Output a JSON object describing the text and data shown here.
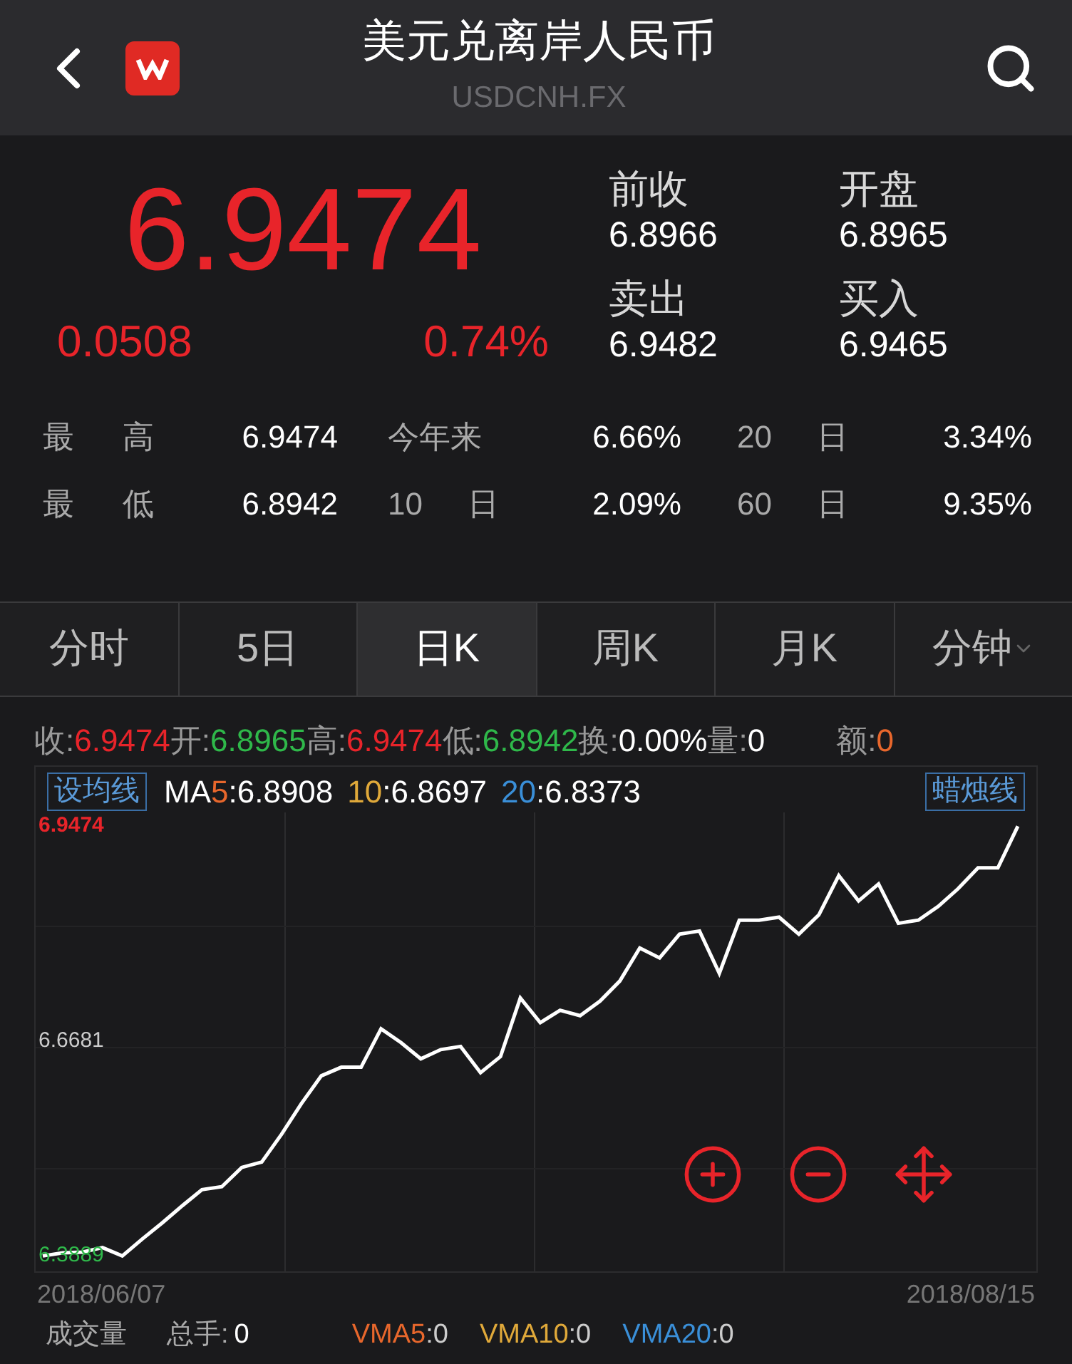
{
  "header": {
    "title": "美元兑离岸人民币",
    "symbol": "USDCNH.FX"
  },
  "quote": {
    "price": "6.9474",
    "change": "0.0508",
    "change_pct": "0.74%"
  },
  "side_stats": [
    {
      "label": "前收",
      "value": "6.8966"
    },
    {
      "label": "开盘",
      "value": "6.8965"
    },
    {
      "label": "卖出",
      "value": "6.9482"
    },
    {
      "label": "买入",
      "value": "6.9465"
    }
  ],
  "stats": [
    [
      {
        "label": "最 高",
        "value": "6.9474"
      },
      {
        "label": "今年来",
        "value": "6.66%"
      },
      {
        "label": "20 日",
        "value": "3.34%"
      }
    ],
    [
      {
        "label": "最 低",
        "value": "6.8942"
      },
      {
        "label": "10 日",
        "value": "2.09%"
      },
      {
        "label": "60 日",
        "value": "9.35%"
      }
    ]
  ],
  "tabs": [
    {
      "label": "分时",
      "selected": false
    },
    {
      "label": "5日",
      "selected": false
    },
    {
      "label": "日K",
      "selected": true
    },
    {
      "label": "周K",
      "selected": false
    },
    {
      "label": "月K",
      "selected": false
    },
    {
      "label": "分钟",
      "selected": false,
      "dropdown": true
    }
  ],
  "info": [
    {
      "label": "收:",
      "value": "6.9474",
      "color": "#e8242a"
    },
    {
      "label": "开:",
      "value": "6.8965",
      "color": "#2fb84a"
    },
    {
      "label": "高:",
      "value": "6.9474",
      "color": "#e8242a"
    },
    {
      "label": "低:",
      "value": "6.8942",
      "color": "#2fb84a"
    },
    {
      "label": "换:",
      "value": "0.00%",
      "color": "#ffffff"
    },
    {
      "label": "量:",
      "value": "0",
      "color": "#ffffff"
    },
    {
      "label": "额:",
      "value": "0",
      "color": "#e8672c"
    }
  ],
  "ma_button": "设均线",
  "candle_button": "蜡烛线",
  "ma": [
    {
      "prefix": "MA",
      "period": "5",
      "value": ":6.8908",
      "color": "#e8672c"
    },
    {
      "period": "10",
      "value": ":6.8697",
      "color": "#e0a93a"
    },
    {
      "period": "20",
      "value": ":6.8373",
      "color": "#3a8fd8"
    }
  ],
  "chart_data": {
    "type": "line",
    "ylim": [
      6.369,
      6.965
    ],
    "yticks": [
      {
        "value": 6.9474,
        "label": "6.9474"
      },
      {
        "value": 6.6681,
        "label": "6.6681"
      },
      {
        "value": 6.3889,
        "label": "6.3889"
      }
    ],
    "series": [
      {
        "color": "#ffffff",
        "values": [
          6.389,
          6.393,
          6.394,
          6.4,
          6.389,
          6.411,
          6.432,
          6.454,
          6.475,
          6.479,
          6.504,
          6.511,
          6.547,
          6.587,
          6.623,
          6.634,
          6.634,
          6.684,
          6.666,
          6.645,
          6.657,
          6.661,
          6.627,
          6.648,
          6.724,
          6.692,
          6.708,
          6.701,
          6.72,
          6.746,
          6.789,
          6.776,
          6.807,
          6.811,
          6.756,
          6.825,
          6.825,
          6.829,
          6.807,
          6.832,
          6.883,
          6.85,
          6.872,
          6.821,
          6.825,
          6.843,
          6.866,
          6.893,
          6.893,
          6.947
        ]
      }
    ]
  },
  "dates": [
    "2018/06/07",
    "2018/08/15"
  ],
  "volume": {
    "label": "成交量",
    "total_label": "总手:",
    "total_value": "0",
    "vma": [
      {
        "name": "VMA5",
        "value": ":0",
        "color": "#e8672c"
      },
      {
        "name": "VMA10",
        "value": ":0",
        "color": "#e0a93a"
      },
      {
        "name": "VMA20",
        "value": ":0",
        "color": "#3a8fd8"
      }
    ]
  }
}
